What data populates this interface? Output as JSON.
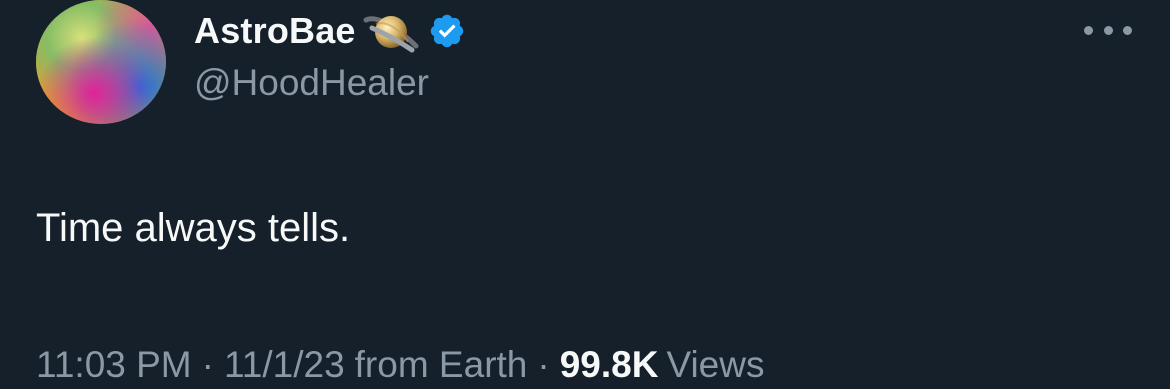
{
  "tweet": {
    "author": {
      "display_name": "AstroBae",
      "name_emoji": "saturn-ringed-planet",
      "verified_badge": "verified-badge-icon",
      "handle": "@HoodHealer",
      "avatar": "rainbow-gradient-avatar"
    },
    "more_menu_icon": "more-options-icon",
    "text": "Time always tells.",
    "meta": {
      "time": "11:03 PM",
      "separator": "·",
      "date": "11/1/23",
      "source": "from Earth",
      "views_count": "99.8K",
      "views_label": "Views"
    }
  },
  "colors": {
    "background": "#15202b",
    "primary_text": "#f7f9f9",
    "secondary_text": "#8b98a5",
    "verified_blue": "#1d9bf0"
  }
}
